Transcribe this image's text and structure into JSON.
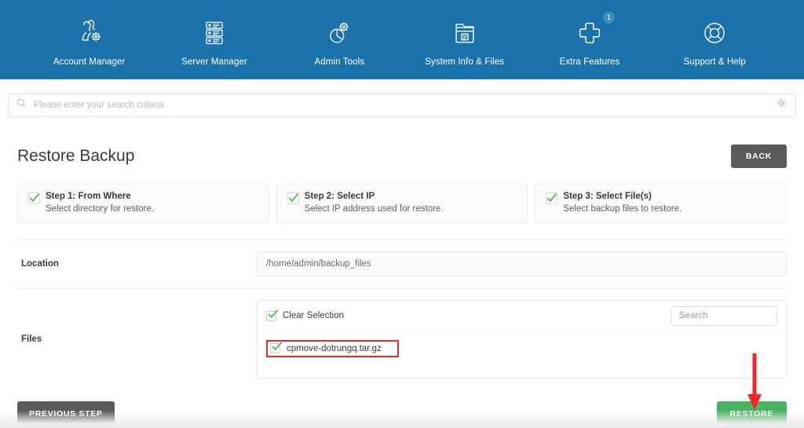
{
  "topnav": {
    "items": [
      {
        "label": "Account Manager",
        "icon": "users-gear-icon",
        "badge": null
      },
      {
        "label": "Server Manager",
        "icon": "server-rack-icon",
        "badge": null
      },
      {
        "label": "Admin Tools",
        "icon": "pie-gear-icon",
        "badge": null
      },
      {
        "label": "System Info & Files",
        "icon": "folder-files-icon",
        "badge": null
      },
      {
        "label": "Extra Features",
        "icon": "plus-cross-icon",
        "badge": "1"
      },
      {
        "label": "Support & Help",
        "icon": "lifebuoy-icon",
        "badge": null
      }
    ]
  },
  "search": {
    "placeholder": "Please enter your search criteria",
    "value": "",
    "left_icon": "search-icon",
    "right_icon": "gear-icon"
  },
  "page": {
    "title": "Restore Backup",
    "back_label": "BACK"
  },
  "steps": [
    {
      "title": "Step 1: From Where",
      "desc": "Select directory for restore.",
      "checked": true
    },
    {
      "title": "Step 2: Select IP",
      "desc": "Select IP address used for restore.",
      "checked": true
    },
    {
      "title": "Step 3: Select File(s)",
      "desc": "Select backup files to restore.",
      "checked": true
    }
  ],
  "form": {
    "location_label": "Location",
    "location_value": "/home/admin/backup_files",
    "files_label": "Files"
  },
  "files_panel": {
    "clear_selection_label": "Clear Selection",
    "clear_selection_checked": true,
    "search_placeholder": "Search",
    "search_value": "",
    "rows": [
      {
        "name": "cpmove-dotrungq.tar.gz",
        "checked": true,
        "highlighted": true
      }
    ]
  },
  "footer": {
    "previous_label": "PREVIOUS STEP",
    "restore_label": "RESTORE"
  },
  "colors": {
    "nav_blue": "#1b72ab",
    "restore_green": "#4cb263",
    "dark_button": "#5a5a5a",
    "check_green": "#5cb85c",
    "annotation_red": "#f0262b"
  }
}
